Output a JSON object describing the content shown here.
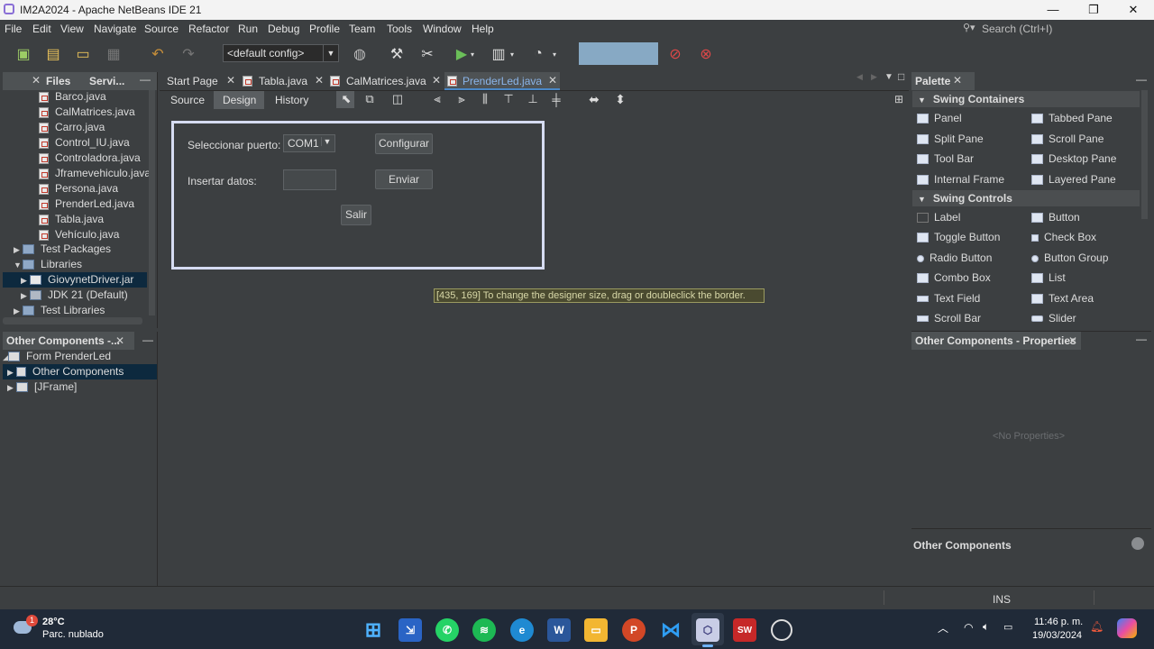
{
  "window": {
    "title": "IM2A2024 - Apache NetBeans IDE 21",
    "minimize_glyph": "—",
    "maximize_glyph": "❐",
    "close_glyph": "✕"
  },
  "menu": [
    "File",
    "Edit",
    "View",
    "Navigate",
    "Source",
    "Refactor",
    "Run",
    "Debug",
    "Profile",
    "Team",
    "Tools",
    "Window",
    "Help"
  ],
  "search": {
    "placeholder": "Search (Ctrl+I)"
  },
  "toolbar": {
    "config_value": "<default config>"
  },
  "left_top_panel": {
    "tabs": [
      "Files",
      "Servi..."
    ],
    "files": [
      "Barco.java",
      "CalMatrices.java",
      "Carro.java",
      "Control_IU.java",
      "Controladora.java",
      "Jframevehiculo.java",
      "Persona.java",
      "PrenderLed.java",
      "Tabla.java",
      "Vehículo.java"
    ],
    "nodes": [
      "Test Packages",
      "Libraries",
      "GiovynetDriver.jar",
      "JDK 21 (Default)",
      "Test Libraries"
    ]
  },
  "left_bottom_panel": {
    "title": "Other Components -...",
    "nodes": [
      "Form PrenderLed",
      "Other Components",
      "[JFrame]"
    ]
  },
  "editor": {
    "tabs": [
      "Start Page",
      "Tabla.java",
      "CalMatrices.java",
      "PrenderLed.java"
    ],
    "view_tabs": [
      "Source",
      "Design",
      "History"
    ],
    "active_view": "Design"
  },
  "form": {
    "port_label": "Seleccionar puerto:",
    "port_value": "COM1",
    "configure_button": "Configurar",
    "data_label": "Insertar datos:",
    "send_button": "Enviar",
    "exit_button": "Salir"
  },
  "designer_hint": "[435, 169] To change the designer size, drag or doubleclick the border.",
  "palette": {
    "title": "Palette",
    "sections": [
      {
        "name": "Swing Containers",
        "items": [
          "Panel",
          "Tabbed Pane",
          "Split Pane",
          "Scroll Pane",
          "Tool Bar",
          "Desktop Pane",
          "Internal Frame",
          "Layered Pane"
        ]
      },
      {
        "name": "Swing Controls",
        "items": [
          "Label",
          "Button",
          "Toggle Button",
          "Check Box",
          "Radio Button",
          "Button Group",
          "Combo Box",
          "List",
          "Text Field",
          "Text Area",
          "Scroll Bar",
          "Slider"
        ]
      }
    ]
  },
  "properties": {
    "title": "Other Components - Properties",
    "empty": "<No Properties>",
    "footer": "Other Components"
  },
  "status": {
    "mode": "INS"
  },
  "taskbar": {
    "weather_temp": "28°C",
    "weather_desc": "Parc. nublado",
    "weather_badge": "1",
    "time": "11:46 p. m.",
    "date": "19/03/2024",
    "apps": [
      "windows-start",
      "netbeans-setup",
      "whatsapp",
      "spotify",
      "edge",
      "word",
      "file-explorer",
      "powerpoint",
      "vscode",
      "netbeans",
      "solidworks-2024",
      "obs"
    ]
  },
  "colors": {
    "accent": "#87a9c4",
    "form_border": "#d6dcf2",
    "taskbar": "#202a38"
  }
}
